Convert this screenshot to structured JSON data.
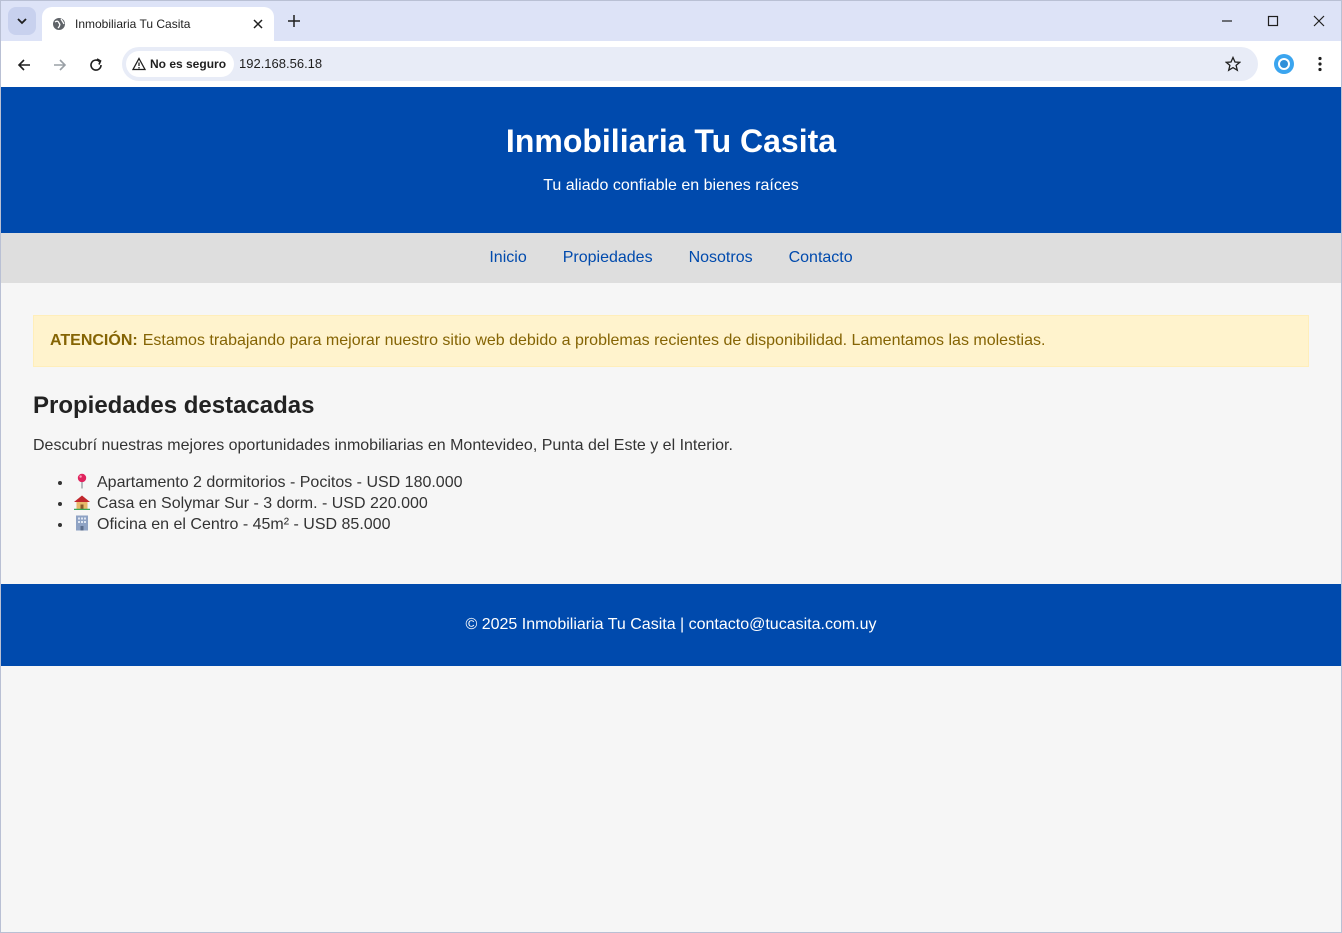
{
  "browser": {
    "tab_title": "Inmobiliaria Tu Casita",
    "security_label": "No es seguro",
    "url": "192.168.56.18"
  },
  "header": {
    "title": "Inmobiliaria Tu Casita",
    "subtitle": "Tu aliado confiable en bienes raíces"
  },
  "nav": {
    "items": [
      {
        "label": "Inicio"
      },
      {
        "label": "Propiedades"
      },
      {
        "label": "Nosotros"
      },
      {
        "label": "Contacto"
      }
    ]
  },
  "alert": {
    "label": "ATENCIÓN:",
    "message": "Estamos trabajando para mejorar nuestro sitio web debido a problemas recientes de disponibilidad. Lamentamos las molestias."
  },
  "featured": {
    "title": "Propiedades destacadas",
    "intro": "Descubrí nuestras mejores oportunidades inmobiliarias en Montevideo, Punta del Este y el Interior.",
    "properties": [
      {
        "icon": "pin-icon",
        "text": "Apartamento 2 dormitorios - Pocitos - USD 180.000"
      },
      {
        "icon": "house-icon",
        "text": "Casa en Solymar Sur - 3 dorm. - USD 220.000"
      },
      {
        "icon": "office-building-icon",
        "text": "Oficina en el Centro - 45m² - USD 85.000"
      }
    ]
  },
  "footer": {
    "text": "© 2025 Inmobiliaria Tu Casita | contacto@tucasita.com.uy"
  },
  "colors": {
    "brand": "#004aad",
    "nav_bg": "#dedede",
    "alert_bg": "#fff3cd",
    "alert_text": "#856404"
  }
}
